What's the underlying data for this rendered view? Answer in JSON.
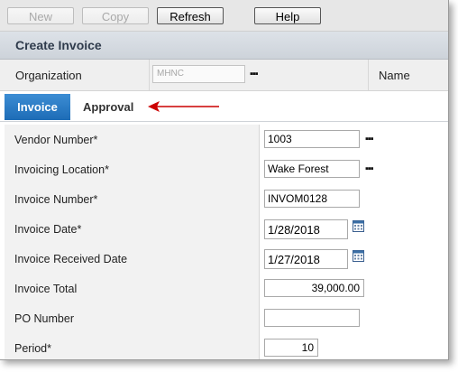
{
  "toolbar": {
    "new_label": "New",
    "copy_label": "Copy",
    "refresh_label": "Refresh",
    "help_label": "Help"
  },
  "page": {
    "title": "Create Invoice"
  },
  "org_row": {
    "organization_label": "Organization",
    "organization_value": "MHNC",
    "lookup_glyph": "▪▪▪",
    "name_label": "Name"
  },
  "tabs": [
    {
      "label": "Invoice",
      "active": true
    },
    {
      "label": "Approval",
      "active": false
    }
  ],
  "fields": {
    "vendor_number": {
      "label": "Vendor Number*",
      "value": "1003"
    },
    "invoicing_location": {
      "label": "Invoicing Location*",
      "value": "Wake Forest"
    },
    "invoice_number": {
      "label": "Invoice Number*",
      "value": "INVOM0128"
    },
    "invoice_date": {
      "label": "Invoice Date*",
      "value": "1/28/2018"
    },
    "invoice_received_date": {
      "label": "Invoice Received Date",
      "value": "1/27/2018"
    },
    "invoice_total": {
      "label": "Invoice Total",
      "value": "39,000.00"
    },
    "po_number": {
      "label": "PO Number",
      "value": ""
    },
    "period": {
      "label": "Period*",
      "value": "10"
    }
  },
  "colors": {
    "active_tab": "#1d6cb6",
    "annotation_arrow": "#cc0000",
    "title_text": "#2f3b4c"
  },
  "icons": [
    "lookup-ellipsis-icon",
    "calendar-icon",
    "annotation-arrow-icon"
  ]
}
